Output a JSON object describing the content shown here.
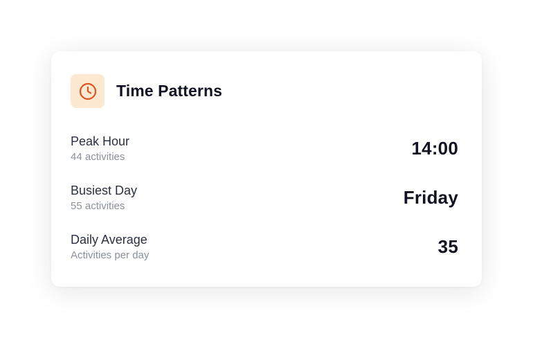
{
  "card": {
    "title": "Time Patterns",
    "icon": "clock-icon",
    "accent_color": "#e0531f",
    "icon_bg": "#fde9d2"
  },
  "rows": [
    {
      "label": "Peak Hour",
      "sub": "44 activities",
      "value": "14:00"
    },
    {
      "label": "Busiest Day",
      "sub": "55 activities",
      "value": "Friday"
    },
    {
      "label": "Daily Average",
      "sub": "Activities per day",
      "value": "35"
    }
  ]
}
